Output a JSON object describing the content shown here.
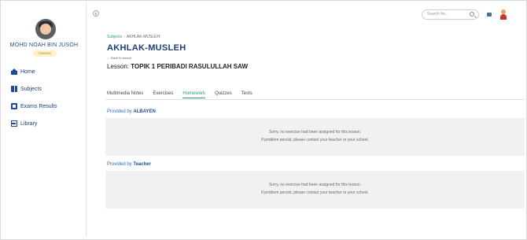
{
  "user": {
    "name": "MOHD NOAH BIN JUSOH",
    "role": "TRAINEE"
  },
  "nav": {
    "items": [
      "Home",
      "Subjects",
      "Exams Results",
      "Library"
    ]
  },
  "search": {
    "placeholder": "Search for..."
  },
  "breadcrumb": {
    "root": "Subjects",
    "current": "AKHLAK-MUSLEH"
  },
  "page": {
    "title": "AKHLAK-MUSLEH",
    "back": "Back to lesson",
    "lesson_prefix": "Lesson:",
    "lesson_name": "TOPIK 1 PERIBADI RASULULLAH SAW"
  },
  "tabs": [
    "Multimedia Notes",
    "Exercises",
    "Homework",
    "Quizzes",
    "Tests"
  ],
  "active_tab": "Homework",
  "sections": [
    {
      "provider_prefix": "Provided by",
      "provider": "ALBAYEN",
      "message_line1": "Sorry, no exercise had been assigned for this lesson.",
      "message_line2": "If problem persist, please contact your teacher or your school."
    },
    {
      "provider_prefix": "Provided by",
      "provider": "Teacher",
      "message_line1": "Sorry, no exercise had been assigned for this lesson.",
      "message_line2": "If problem persist, please contact your teacher or your school."
    }
  ],
  "colors": {
    "accent": "#2f9e73",
    "primary": "#1e4a99",
    "panel": "#f1f1f1"
  }
}
